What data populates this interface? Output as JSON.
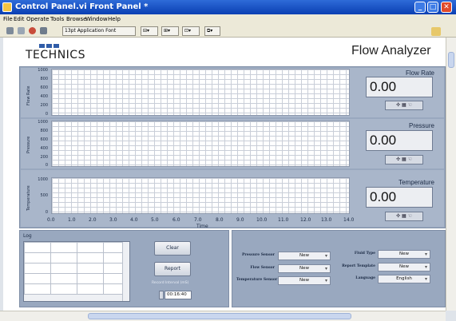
{
  "window": {
    "title": "Control Panel.vi Front Panel *"
  },
  "menu": [
    "File",
    "Edit",
    "Operate",
    "Tools",
    "Browse",
    "Window",
    "Help"
  ],
  "toolbar": {
    "font_select": "13pt Application Font"
  },
  "header": {
    "logo_text": "TECHNICS",
    "app_title": "Flow Analyzer"
  },
  "charts": [
    {
      "name": "flow",
      "ylabel": "Flow Rate",
      "yticks": [
        "1000",
        "800",
        "600",
        "400",
        "200",
        "0"
      ],
      "indicator_label": "Flow Rate",
      "value": "0.00"
    },
    {
      "name": "pressure",
      "ylabel": "Pressure",
      "yticks": [
        "1000",
        "800",
        "600",
        "400",
        "200",
        "0"
      ],
      "indicator_label": "Pressure",
      "value": "0.00"
    },
    {
      "name": "temperature",
      "ylabel": "Temperature",
      "yticks": [
        "1000",
        "500",
        "0"
      ],
      "indicator_label": "Temperature",
      "value": "0.00"
    }
  ],
  "xaxis": {
    "ticks": [
      "0.0",
      "1.0",
      "2.0",
      "3.0",
      "4.0",
      "5.0",
      "6.0",
      "7.0",
      "8.0",
      "9.0",
      "10.0",
      "11.0",
      "12.0",
      "13.0",
      "14.0"
    ],
    "title": "Time"
  },
  "log": {
    "label": "Log"
  },
  "buttons": {
    "clear": "Clear",
    "report": "Report"
  },
  "record_interval": {
    "label": "Record Interval (mS)",
    "value": "00:16:40"
  },
  "options_left": [
    {
      "label": "Pressure Sensor",
      "value": "New"
    },
    {
      "label": "Flow Sensor",
      "value": "New"
    },
    {
      "label": "Temperature Sensor",
      "value": "New"
    }
  ],
  "options_right": [
    {
      "label": "Fluid Type",
      "value": "New"
    },
    {
      "label": "Report Template",
      "value": "New"
    },
    {
      "label": "Language",
      "value": "English"
    }
  ],
  "colors": {
    "panel": "#99a8bf",
    "titlebar": "#0a3fb3",
    "logo": "#2f5ca8"
  }
}
